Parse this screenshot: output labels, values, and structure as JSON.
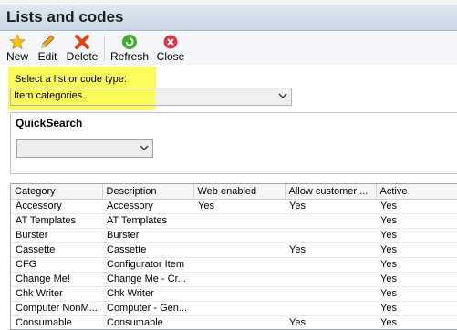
{
  "window": {
    "title": "Lists and codes"
  },
  "toolbar": {
    "new_label": "New",
    "edit_label": "Edit",
    "delete_label": "Delete",
    "refresh_label": "Refresh",
    "close_label": "Close"
  },
  "selector": {
    "label": "Select a list or code type:",
    "value": "Item categories",
    "highlight_color": "#fbfb5a"
  },
  "quicksearch": {
    "label": "QuickSearch",
    "value": ""
  },
  "grid": {
    "columns": [
      "Category",
      "Description",
      "Web enabled",
      "Allow customer ...",
      "Active"
    ],
    "rows": [
      [
        "Accessory",
        "Accessory",
        "Yes",
        "Yes",
        "Yes"
      ],
      [
        "AT Templates",
        "AT Templates",
        "",
        "",
        "Yes"
      ],
      [
        "Burster",
        "Burster",
        "",
        "",
        "Yes"
      ],
      [
        "Cassette",
        "Cassette",
        "",
        "Yes",
        "Yes"
      ],
      [
        "CFG",
        "Configurator Item",
        "",
        "",
        "Yes"
      ],
      [
        "Change Me!",
        "Change Me - Cr...",
        "",
        "",
        "Yes"
      ],
      [
        "Chk Writer",
        "Chk Writer",
        "",
        "",
        "Yes"
      ],
      [
        "Computer NonM...",
        "Computer - Gen...",
        "",
        "",
        "Yes"
      ],
      [
        "Consumable",
        "Consumable",
        "",
        "Yes",
        "Yes"
      ]
    ]
  }
}
